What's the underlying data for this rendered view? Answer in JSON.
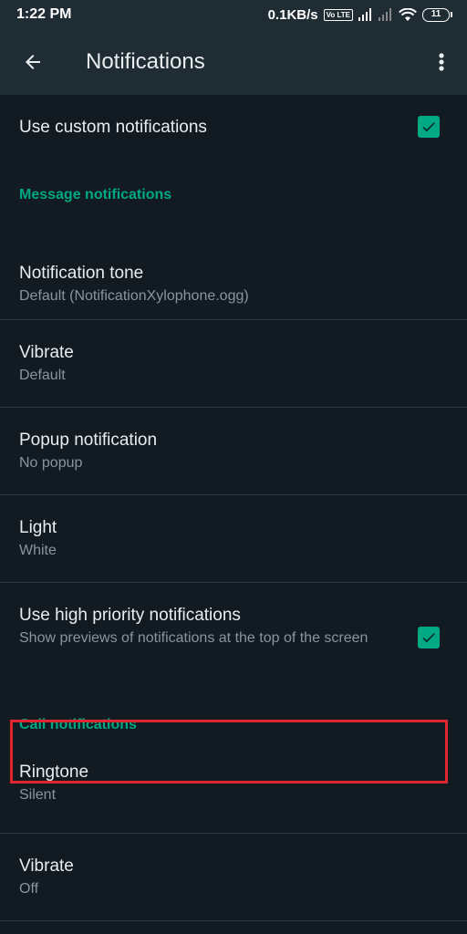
{
  "status_bar": {
    "time": "1:22 PM",
    "speed": "0.1KB/s",
    "volte": "Vo LTE",
    "battery": "11"
  },
  "app_bar": {
    "title": "Notifications",
    "back_icon": "arrow-back-icon",
    "menu_icon": "more-vert-icon"
  },
  "settings": {
    "custom": {
      "title": "Use custom notifications",
      "checked": true
    },
    "message_header": "Message notifications",
    "tone": {
      "title": "Notification tone",
      "value": "Default (NotificationXylophone.ogg)"
    },
    "vibrate": {
      "title": "Vibrate",
      "value": "Default"
    },
    "popup": {
      "title": "Popup notification",
      "value": "No popup"
    },
    "light": {
      "title": "Light",
      "value": "White"
    },
    "high_priority": {
      "title": "Use high priority notifications",
      "value": "Show previews of notifications at the top of the screen",
      "checked": true
    },
    "call_header": "Call notifications",
    "ringtone": {
      "title": "Ringtone",
      "value": "Silent"
    },
    "call_vibrate": {
      "title": "Vibrate",
      "value": "Off"
    }
  },
  "colors": {
    "background": "#121b22",
    "toolbar": "#1f2c34",
    "accent": "#00a884",
    "highlight_box": "#e1252f"
  }
}
